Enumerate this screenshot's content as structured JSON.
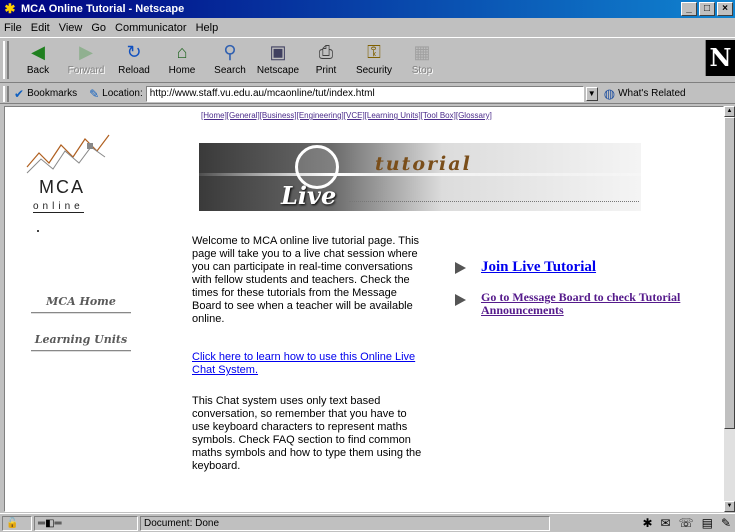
{
  "window": {
    "title": "MCA Online Tutorial - Netscape",
    "controls": [
      "_",
      "□",
      "×"
    ]
  },
  "menubar": {
    "items": [
      {
        "label": "File"
      },
      {
        "label": "Edit"
      },
      {
        "label": "View"
      },
      {
        "label": "Go"
      },
      {
        "label": "Communicator"
      },
      {
        "label": "Help"
      }
    ]
  },
  "toolbar": {
    "buttons": [
      {
        "label": "Back",
        "icon": "back-arrow-icon",
        "glyph": "◀",
        "color": "#208020",
        "enabled": true
      },
      {
        "label": "Forward",
        "icon": "forward-arrow-icon",
        "glyph": "▶",
        "color": "#90b090",
        "enabled": false
      },
      {
        "label": "Reload",
        "icon": "reload-icon",
        "glyph": "↻",
        "color": "#1050c0",
        "enabled": true
      },
      {
        "label": "Home",
        "icon": "home-icon",
        "glyph": "⌂",
        "color": "#2a6a2a",
        "enabled": true
      },
      {
        "label": "Search",
        "icon": "search-icon",
        "glyph": "⚲",
        "color": "#3060b0",
        "enabled": true
      },
      {
        "label": "Netscape",
        "icon": "netscape-icon",
        "glyph": "▣",
        "color": "#404060",
        "enabled": true
      },
      {
        "label": "Print",
        "icon": "print-icon",
        "glyph": "⎙",
        "color": "#404040",
        "enabled": true
      },
      {
        "label": "Security",
        "icon": "lock-icon",
        "glyph": "🔒",
        "color": "#806000",
        "enabled": true
      },
      {
        "label": "Stop",
        "icon": "stop-icon",
        "glyph": "▦",
        "color": "#a0a0a0",
        "enabled": false
      }
    ],
    "brand_letter": "N"
  },
  "location_bar": {
    "bookmarks_label": "Bookmarks",
    "location_label": "Location:",
    "url": "http://www.staff.vu.edu.au/mcaonline/tut/index.html",
    "related_label": "What's Related"
  },
  "page": {
    "top_nav": [
      "[Home]",
      "[General]",
      "[Business]",
      "[Engineering]",
      "[VCE]",
      "[Learning Units]",
      "[Tool Box]",
      "[Glossary]"
    ],
    "logo": {
      "line1": "MCA",
      "line2": "online"
    },
    "banner": {
      "word1": "Live",
      "word2": "tutorial"
    },
    "side_nav": [
      {
        "label": "MCA Home"
      },
      {
        "label": "Learning Units"
      }
    ],
    "intro_text": "Welcome to MCA online live tutorial page. This page will take you to a live chat session where you can participate in real-time conversations with fellow students and teachers. Check the times for these tutorials from the Message Board to see when a teacher will be available online.",
    "howto_link": "Click here to learn how to use this Online Live Chat System.",
    "chat_info": "This Chat system uses only text based conversation, so remember that you have to use keyboard characters to represent maths symbols. Check FAQ section to find common maths symbols and how to type them using the keyboard.",
    "join_link": "Join Live Tutorial",
    "message_board_link": "Go to Message Board to check Tutorial Announcements"
  },
  "status": {
    "text": "Document: Done"
  }
}
